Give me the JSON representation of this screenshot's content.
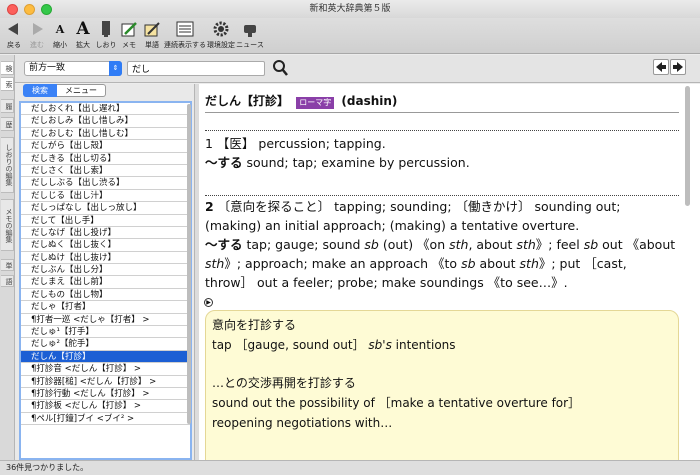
{
  "window": {
    "title": "新和英大辞典第５版"
  },
  "toolbar": {
    "back": "戻る",
    "forward": "進む",
    "shrink": "縮小",
    "enlarge": "拡大",
    "bookmark": "しおり",
    "memo": "メモ",
    "wordbook": "単語",
    "continuous": "連続表示する",
    "settings": "環境設定",
    "news": "ニュース"
  },
  "sidetabs": [
    "検",
    "索",
    "履",
    "歴",
    "しおりの編集",
    "メモの編集",
    "単",
    "語"
  ],
  "search": {
    "mode": "前方一致",
    "query": "だし"
  },
  "left_tabs": {
    "search": "検索",
    "menu": "メニュー"
  },
  "results": [
    "だしおくれ【出し遅れ】",
    "だしおしみ【出し惜しみ】",
    "だしおしむ【出し惜しむ】",
    "だしがら【出し殻】",
    "だしきる【出し切る】",
    "だしさく【出し索】",
    "だししぶる【出し渋る】",
    "だしじる【出し汁】",
    "だしっぱなし【出しっ放し】",
    "だして【出し手】",
    "だしなげ【出し投げ】",
    "だしぬく【出し抜く】",
    "だしぬけ【出し抜け】",
    "だしぶん【出し分】",
    "だしまえ【出し前】",
    "だしもの【出し物】",
    "だしゃ【打者】",
    "¶打者一巡 <だしゃ【打者】 >",
    "だしゅ¹【打手】",
    "だしゅ²【舵手】",
    "だしん【打診】",
    "¶打診音 <だしん【打診】 >",
    "¶打診器[槌] <だしん【打診】 >",
    "¶打診行動 <だしん【打診】 >",
    "¶打診板 <だしん【打診】 >",
    "¶ペル[打鐘]ブイ <ブイ² >"
  ],
  "selected_index": 20,
  "entry": {
    "headword": "だしん【打診】",
    "romaji_badge": "ローマ字",
    "romaji": "(dashin)",
    "sense1_line1": "1 【医】 percussion; tapping.",
    "sense1_line2_bold": "～する",
    "sense1_line2": " sound; tap; examine by percussion.",
    "sense2_html": "<b>2</b> 〔意向を探ること〕 tapping; sounding; 〔働きかけ〕 sounding out; (making) an initial approach; (making) a tentative overture.<br><b>～する</b> tap; gauge; sound <i>sb</i> (out) 《on <i>sth</i>, about <i>sth</i>》; feel <i>sb</i> out 《about <i>sth</i>》; approach; make an approach 《to <i>sb</i> about <i>sth</i>》; put ［cast, throw］ out a feeler; probe; make soundings 《to see…》.",
    "examples": [
      "意向を打診する",
      "tap ［gauge, sound out］ sb's intentions",
      "…との交渉再開を打診する",
      "sound out the possibility of ［make a tentative overture for］",
      "reopening negotiations with…"
    ]
  },
  "status": "36件見つかりました。"
}
